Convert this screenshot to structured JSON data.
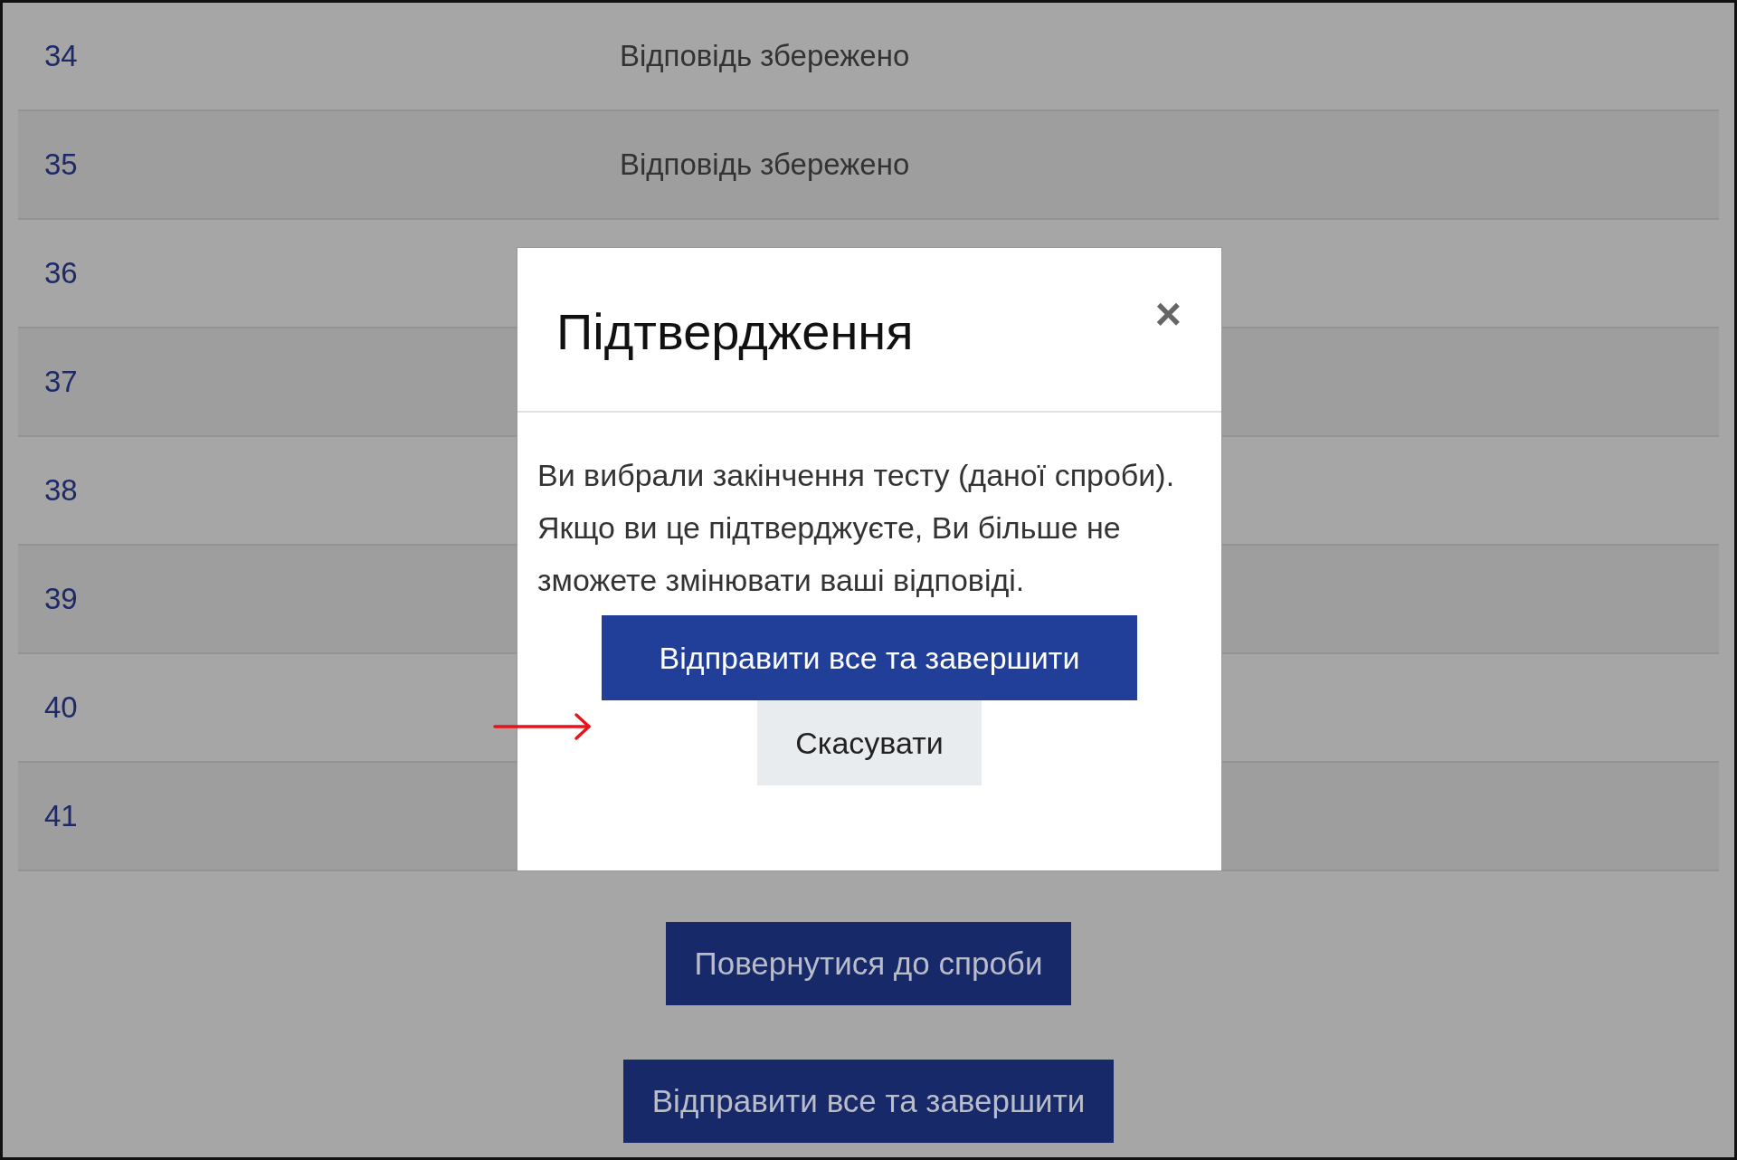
{
  "rows": [
    {
      "number": "34",
      "status": "Відповідь збережено"
    },
    {
      "number": "35",
      "status": "Відповідь збережено"
    },
    {
      "number": "36"
    },
    {
      "number": "37"
    },
    {
      "number": "38"
    },
    {
      "number": "39"
    },
    {
      "number": "40"
    },
    {
      "number": "41"
    }
  ],
  "page_buttons": [
    "Повернутися до спроби",
    "Відправити все та завершити"
  ],
  "dialog": {
    "title": "Підтвердження",
    "close": "×",
    "message": "Ви вибрали закінчення тесту (даної спроби). Якщо ви це підтверджуєте, Ви більше не зможете змінювати ваші відповіді.",
    "confirm": "Відправити все та завершити",
    "cancel": "Скасувати"
  }
}
